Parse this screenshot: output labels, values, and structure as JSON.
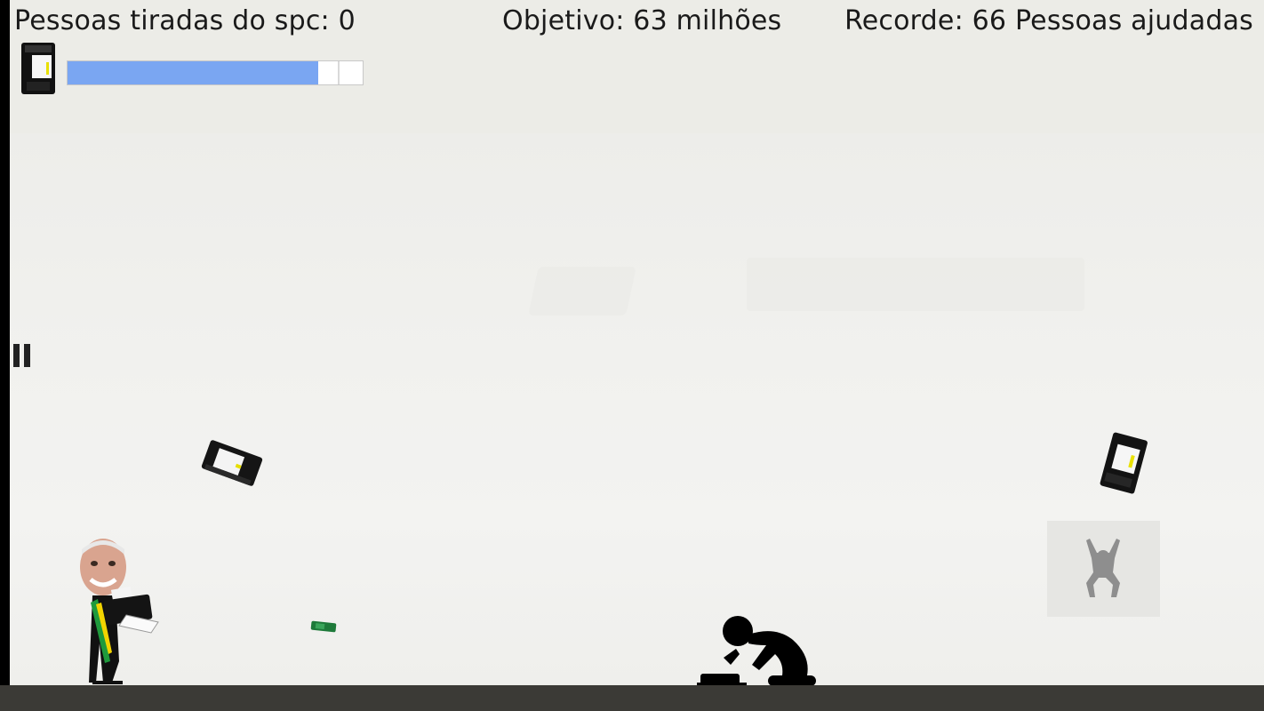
{
  "hud": {
    "score_label": "Pessoas tiradas do spc: 0",
    "objective_label": "Objetivo: 63 milhões",
    "record_label": "Recorde: 66 Pessoas ajudadas"
  },
  "ammo": {
    "level": 0.85,
    "fill_color": "#7aa6f2",
    "icon": "printer-icon"
  },
  "controls": {
    "pause_icon": "pause-icon",
    "jump_icon": "jumping-person-icon"
  },
  "colors": {
    "background": "#ecece7",
    "ground": "#3b3a36",
    "text": "#1a1a1a"
  }
}
